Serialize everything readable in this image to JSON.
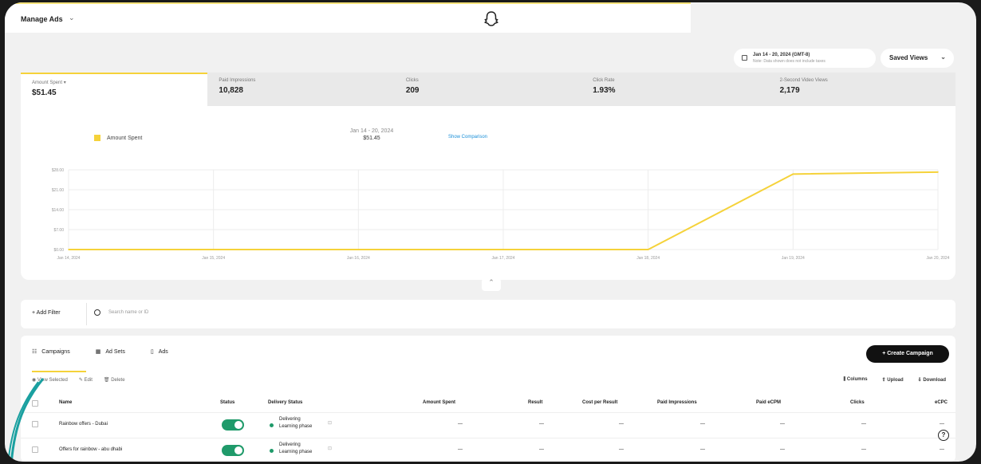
{
  "header": {
    "title": "Manage Ads",
    "chevron": "⌄"
  },
  "toolbar": {
    "date_range": "Jan 14 - 20, 2024 (GMT-8)",
    "date_note": "Note: Data shown does not include taxes",
    "saved_views": "Saved Views"
  },
  "metrics": [
    {
      "label": "Amount Spent",
      "value": "$51.45"
    },
    {
      "label": "Paid Impressions",
      "value": "10,828"
    },
    {
      "label": "Clicks",
      "value": "209"
    },
    {
      "label": "Click Rate",
      "value": "1.93%"
    },
    {
      "label": "2-Second Video Views",
      "value": "2,179"
    }
  ],
  "chart_legend": {
    "series": "Amount Spent",
    "period": "Jan 14 - 20, 2024",
    "period_value": "$51.45",
    "compare": "Show Comparison"
  },
  "chart_data": {
    "type": "line",
    "x": [
      "Jan 14, 2024",
      "Jan 15, 2024",
      "Jan 16, 2024",
      "Jan 17, 2024",
      "Jan 18, 2024",
      "Jan 19, 2024",
      "Jan 20, 2024"
    ],
    "values": [
      0,
      0,
      0,
      0,
      0,
      26.5,
      27.2
    ],
    "ylim": [
      0,
      28
    ],
    "yticks": [
      "$0.00",
      "$7.00",
      "$14.00",
      "$21.00",
      "$28.00"
    ],
    "color": "#f5d23a",
    "grid": true
  },
  "filters": {
    "add_filter": "Add Filter",
    "search_placeholder": "Search name or ID"
  },
  "tabs": [
    {
      "label": "Campaigns"
    },
    {
      "label": "Ad Sets"
    },
    {
      "label": "Ads"
    }
  ],
  "create_button": "Create Campaign",
  "row_actions": {
    "view": "View Selected",
    "edit": "Edit",
    "delete": "Delete"
  },
  "table_actions": {
    "columns": "Columns",
    "upload": "Upload",
    "download": "Download"
  },
  "table": {
    "columns": [
      "Name",
      "Status",
      "Delivery Status",
      "Amount Spent",
      "Result",
      "Cost per Result",
      "Paid Impressions",
      "Paid eCPM",
      "Clicks",
      "eCPC"
    ],
    "rows": [
      {
        "name": "Rainbow offers - Dubai",
        "delivery": "Delivering",
        "delivery_sub": "Learning phase",
        "dash": "—"
      },
      {
        "name": "Offers for rainbow - abu dhabi",
        "delivery": "Delivering",
        "delivery_sub": "Learning phase",
        "dash": "—"
      }
    ]
  },
  "help": "?"
}
